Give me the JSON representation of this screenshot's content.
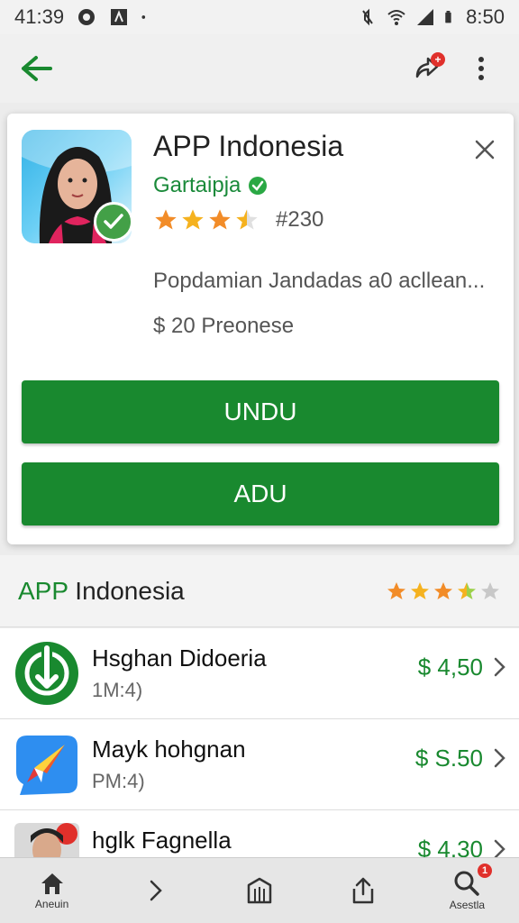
{
  "status_bar": {
    "time_left": "41:39",
    "time_right": "8:50"
  },
  "app_bar": {
    "share_badge": "+"
  },
  "app_card": {
    "title": "APP Indonesia",
    "developer": "Gartaipja",
    "rating": 3.5,
    "rank": "#230",
    "description": "Popdamian Jandadas a0 acllean...",
    "price": "$ 20  Preonese",
    "primary_button": "UNDU",
    "secondary_button": "ADU"
  },
  "section": {
    "title_accent": "APP",
    "title_rest": " Indonesia",
    "rating": 3.5
  },
  "list": [
    {
      "title": "Hsghan Didoeria",
      "subtitle": "1M:4)",
      "price": "$ 4,50",
      "icon": "download-icon"
    },
    {
      "title": "Mayk hohgnan",
      "subtitle": "PM:4)",
      "price": "$ S.50",
      "icon": "compass-icon"
    },
    {
      "title": "hglk Fagnella",
      "subtitle": "",
      "price": "$ 4.30",
      "icon": "person-avatar"
    }
  ],
  "bottom_nav": [
    {
      "label": "Aneuin",
      "icon": "home-icon"
    },
    {
      "label": "",
      "icon": "chevron-right-icon"
    },
    {
      "label": "",
      "icon": "library-icon"
    },
    {
      "label": "",
      "icon": "upload-icon"
    },
    {
      "label": "Asestla",
      "icon": "search-icon",
      "badge": "1"
    }
  ],
  "colors": {
    "accent": "#19892f",
    "badge": "#e0302b",
    "star": "#f5a623"
  }
}
